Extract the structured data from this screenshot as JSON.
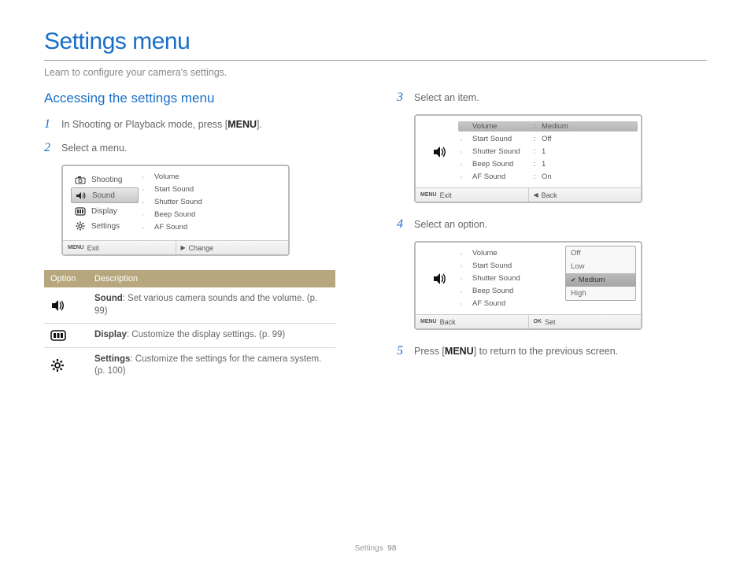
{
  "title": "Settings menu",
  "subtitle": "Learn to configure your camera's settings.",
  "heading": "Accessing the settings menu",
  "steps": {
    "s1_a": "In Shooting or Playback mode, press [",
    "s1_b": "].",
    "s2": "Select a menu.",
    "s3": "Select an item.",
    "s4": "Select an option.",
    "s5_a": "Press [",
    "s5_b": "] to return to the previous screen."
  },
  "menu_word": "MENU",
  "lcd1": {
    "left": [
      "Shooting",
      "Sound",
      "Display",
      "Settings"
    ],
    "right": [
      "Volume",
      "Start Sound",
      "Shutter Sound",
      "Beep Sound",
      "AF Sound"
    ],
    "foot_left": "Exit",
    "foot_right": "Change",
    "foot_left_icon": "MENU"
  },
  "lcd2": {
    "rows": [
      {
        "label": "Volume",
        "value": "Medium"
      },
      {
        "label": "Start Sound",
        "value": "Off"
      },
      {
        "label": "Shutter Sound",
        "value": "1"
      },
      {
        "label": "Beep Sound",
        "value": "1"
      },
      {
        "label": "AF Sound",
        "value": "On"
      }
    ],
    "foot_left": "Exit",
    "foot_right": "Back",
    "foot_left_icon": "MENU"
  },
  "lcd3": {
    "labels": [
      "Volume",
      "Start Sound",
      "Shutter Sound",
      "Beep Sound",
      "AF Sound"
    ],
    "options": [
      "Off",
      "Low",
      "Medium",
      "High"
    ],
    "foot_left": "Back",
    "foot_right": "Set",
    "foot_left_icon": "MENU",
    "foot_right_icon": "OK"
  },
  "table": {
    "head_option": "Option",
    "head_desc": "Description",
    "rows": [
      {
        "bold": "Sound",
        "rest": ": Set various camera sounds and the volume. (p. 99)"
      },
      {
        "bold": "Display",
        "rest": ": Customize the display settings. (p. 99)"
      },
      {
        "bold": "Settings",
        "rest": ": Customize the settings for the camera system. (p. 100)"
      }
    ]
  },
  "footer": {
    "section": "Settings",
    "page": "98"
  }
}
